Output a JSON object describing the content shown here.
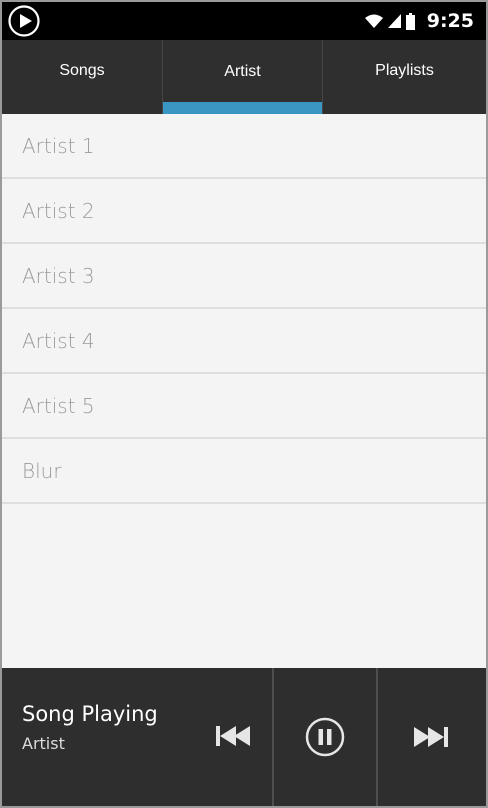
{
  "status_bar": {
    "time": "9:25",
    "app_icon": "play-circle-icon",
    "icons": [
      "wifi-icon",
      "signal-icon",
      "battery-icon"
    ]
  },
  "tabs": [
    {
      "label": "Songs",
      "active": false
    },
    {
      "label": "Artist",
      "active": true
    },
    {
      "label": "Playlists",
      "active": false
    }
  ],
  "artists": [
    {
      "name": "Artist 1"
    },
    {
      "name": "Artist 2"
    },
    {
      "name": "Artist 3"
    },
    {
      "name": "Artist 4"
    },
    {
      "name": "Artist 5"
    },
    {
      "name": "Blur"
    }
  ],
  "player": {
    "title": "Song Playing",
    "artist": "Artist",
    "controls": [
      "previous-icon",
      "pause-icon",
      "next-icon"
    ]
  },
  "colors": {
    "tab_indicator": "#3a97c4",
    "tab_bar": "#2f2f2f",
    "player_bar": "#2e2e2e",
    "list_background": "#f4f4f4",
    "list_text": "#9b9b9b"
  }
}
